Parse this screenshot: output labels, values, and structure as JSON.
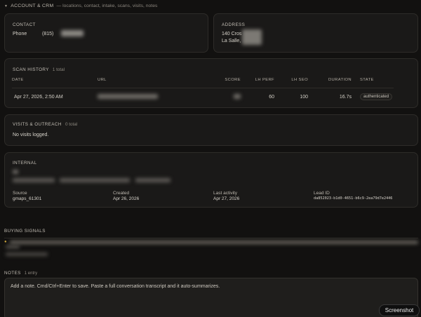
{
  "header": {
    "title": "ACCOUNT & CRM",
    "subtitle": "— locations, contact, intake, scans, visits, notes"
  },
  "contact": {
    "label": "CONTACT",
    "phone_label": "Phone",
    "phone_value": "(815)"
  },
  "address": {
    "label": "ADDRESS",
    "line1": "140 Cros",
    "line2": "La Salle,"
  },
  "scan_history": {
    "label": "SCAN HISTORY",
    "count": "1 total",
    "columns": [
      "DATE",
      "URL",
      "SCORE",
      "LH PERF",
      "LH SEO",
      "DURATION",
      "STATE"
    ],
    "rows": [
      {
        "date": "Apr 27, 2026, 2:50 AM",
        "url": "",
        "score": "",
        "lh_perf": "60",
        "lh_seo": "100",
        "duration": "16.7s",
        "state": "authenticated"
      }
    ]
  },
  "visits": {
    "label": "VISITS & OUTREACH",
    "count": "0 total",
    "empty": "No visits logged."
  },
  "internal": {
    "label": "INTERNAL",
    "source_label": "Source",
    "source_value": "gmaps_61301",
    "created_label": "Created",
    "created_value": "Apr 26, 2026",
    "activity_label": "Last activity",
    "activity_value": "Apr 27, 2026",
    "leadid_label": "Lead ID",
    "leadid_value": "da852023-b1d0-4651-b6c9-2ea79d7e2446"
  },
  "buying_signals": {
    "label": "BUYING SIGNALS"
  },
  "notes": {
    "label": "NOTES",
    "count": "1 entry",
    "placeholder": "Add a note. Cmd/Ctrl+Enter to save. Paste a full conversation transcript and it auto-summarizes."
  },
  "screenshot_button": "Screenshot"
}
